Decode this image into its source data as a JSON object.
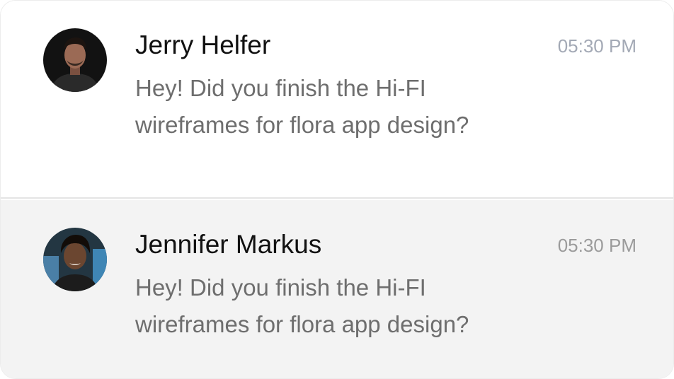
{
  "messages": [
    {
      "sender": "Jerry Helfer",
      "time": "05:30 PM",
      "preview_lines": [
        "Hey! Did you finish the Hi-FI",
        "wireframes for flora app design?"
      ],
      "avatar": "profile-photo-man"
    },
    {
      "sender": "Jennifer Markus",
      "time": "05:30 PM",
      "preview_lines": [
        "Hey! Did you finish the Hi-FI",
        "wireframes for flora app design?"
      ],
      "avatar": "profile-photo-woman"
    }
  ],
  "colors": {
    "name_text": "#111111",
    "preview_text": "#6e6e6e",
    "time_text": "#a3a9b5",
    "selected_row_bg": "#f3f3f3",
    "divider": "#e4e4e4"
  }
}
